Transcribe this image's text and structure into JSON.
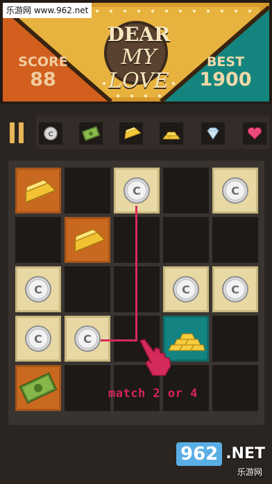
{
  "watermark": {
    "top": "乐游网 www.962.net",
    "bottom_num": "962",
    "bottom_net": ".NET",
    "bottom_sub": "乐游网"
  },
  "header": {
    "title_line1": "DEAR",
    "title_line2": "MY LOVE",
    "score_label": "SCORE",
    "score_value": "88",
    "best_label": "BEST",
    "best_value": "1900"
  },
  "toolbar": {
    "items": [
      {
        "name": "coin-icon"
      },
      {
        "name": "dollar-bills-icon"
      },
      {
        "name": "gold-bar-icon"
      },
      {
        "name": "gold-bars-stack-icon"
      },
      {
        "name": "diamond-icon"
      },
      {
        "name": "heart-gem-icon"
      }
    ]
  },
  "board": {
    "rows": [
      [
        "gold-bar",
        "empty",
        "coin",
        "empty",
        "coin"
      ],
      [
        "empty",
        "gold-bar",
        "empty",
        "empty",
        "empty"
      ],
      [
        "coin",
        "empty",
        "empty",
        "coin",
        "coin"
      ],
      [
        "coin",
        "coin",
        "empty",
        "gold-pile",
        "empty"
      ],
      [
        "cash",
        "empty",
        "empty",
        "empty",
        "empty"
      ]
    ],
    "coin_letter": "C"
  },
  "hint": {
    "text": "match 2 or 4"
  },
  "colors": {
    "orange_tile": "#c9691f",
    "cream_tile": "#e7d8a4",
    "teal_tile": "#138481",
    "hint_pink": "#d62a58",
    "pause_gold": "#e8b458"
  }
}
